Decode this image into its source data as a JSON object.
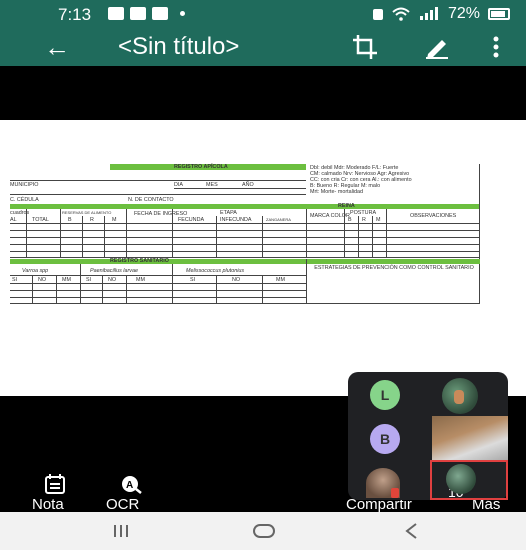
{
  "status_bar": {
    "time": "7:13",
    "battery": "72%"
  },
  "app_bar": {
    "title": "<Sin título>"
  },
  "document": {
    "title": "REGISTRO APÍCOLA",
    "legend_lines": [
      "Dbl: debil Mdr: Moderado F/L: Fuerte",
      "CM: calmado Nrv: Nervioso Agr: Agresivo",
      "CC: con cria Cr: con cera Al.: con alimento",
      "B: Bueno R: Regular M: malo",
      "Mrt: Morte- mortalidad"
    ],
    "labels": {
      "municipio": "MUNICIPIO",
      "dia": "DIA",
      "mes": "MES",
      "anio": "AÑO",
      "cedula": "C. CÉDULA",
      "contacto": "N. DE CONTACTO",
      "reina": "REINA",
      "cuadros": "cuadros",
      "total": "TOTAL",
      "reservas": "RESERVAS DE ALIMENTO",
      "b": "B",
      "r": "R",
      "m": "M",
      "fecha": "FECHA DE INGRESO",
      "etapa": "ETAPA",
      "fecunda": "FECUNDA",
      "infecunda": "INFECUNDA",
      "zanganera": "ZANGANERA",
      "marca": "MARCA COLOR",
      "postura": "POSTURA",
      "observaciones": "OBSERVACIONES",
      "sanitario": "REGISTRO SANITARIO",
      "varroa": "Varroa spp",
      "paeni": "Paenibacillus larvae",
      "meliss": "Melissococcus plutonius",
      "si": "SI",
      "no": "NO",
      "mm": "MM",
      "estrategias": "ESTRATEGIAS DE PREVENCIÓN COMO CONTROL SANITARIO"
    }
  },
  "participants": {
    "b_initial": "B",
    "l_initial": "L",
    "count": "10"
  },
  "toolbar": {
    "nota_label": "Nota",
    "ocr_label": "OCR",
    "compartir_label": "Compartir",
    "mas_label": "Más"
  },
  "colors": {
    "header": "#1f6b5c",
    "doc_green": "#6cbf3f",
    "avatar_l": "#86d48a",
    "avatar_b": "#b7a9f0"
  }
}
